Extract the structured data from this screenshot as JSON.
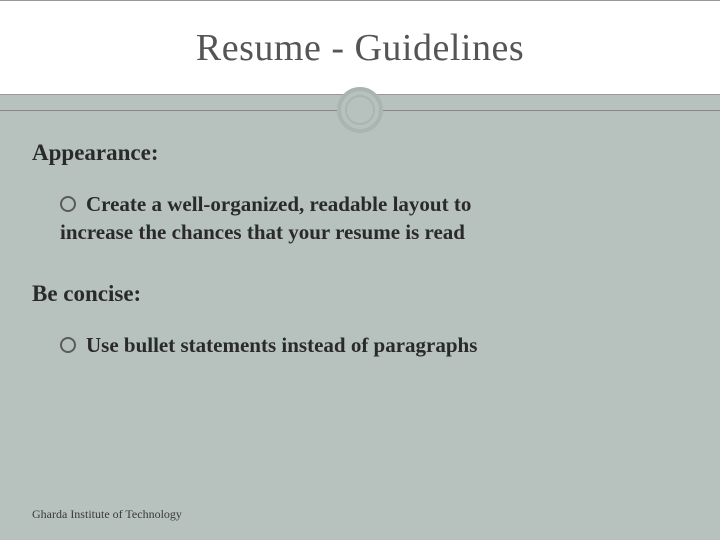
{
  "title": "Resume - Guidelines",
  "sections": [
    {
      "heading": "Appearance:",
      "bullet_line1": "Create a well-organized, readable layout to",
      "bullet_line2": "increase the chances that your resume is read"
    },
    {
      "heading": "Be concise:",
      "bullet_line1": "Use bullet statements instead of paragraphs",
      "bullet_line2": ""
    }
  ],
  "footer": "Gharda Institute of Technology"
}
